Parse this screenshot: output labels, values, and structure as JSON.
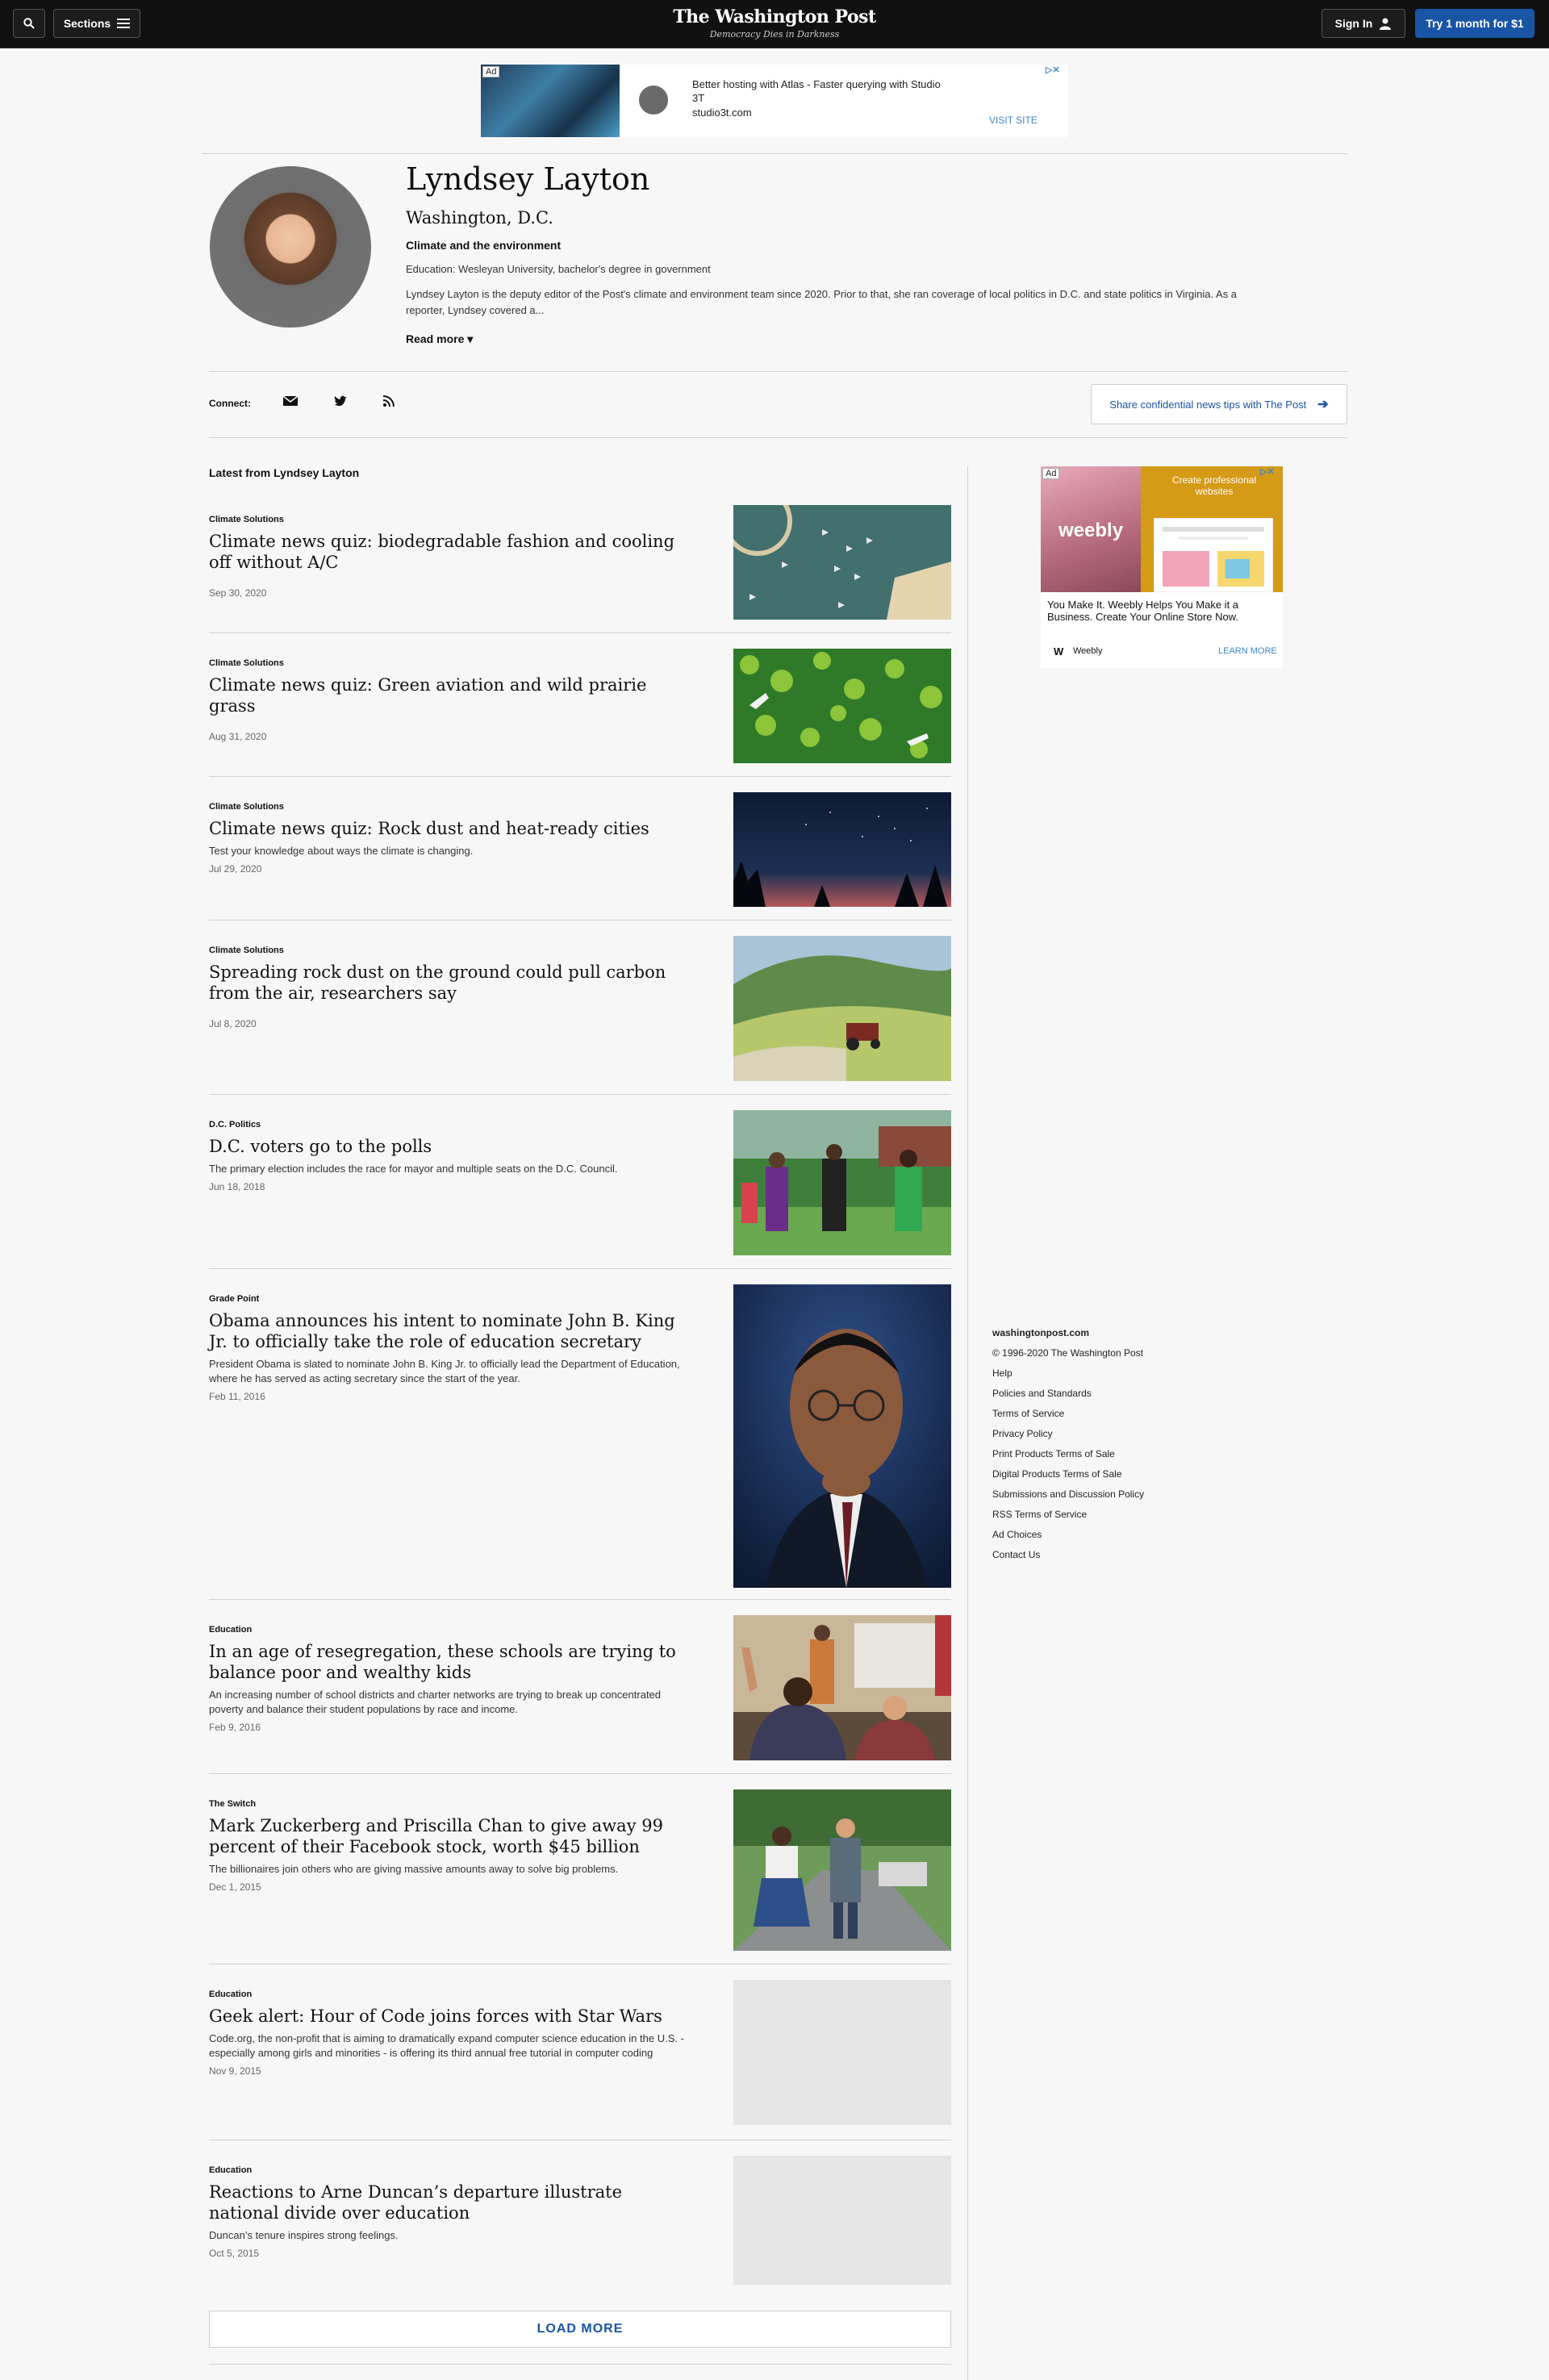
{
  "header": {
    "sections_label": "Sections",
    "logo_name": "The Washington Post",
    "logo_tagline": "Democracy Dies in Darkness",
    "signin_label": "Sign In",
    "trial_label": "Try 1 month for $1"
  },
  "top_ad": {
    "badge": "Ad",
    "title": "Better hosting with Atlas - Faster querying with Studio 3T",
    "domain": "studio3t.com",
    "cta": "VISIT SITE"
  },
  "author": {
    "name": "Lyndsey Layton",
    "location": "Washington, D.C.",
    "beat": "Climate and the environment",
    "education": "Education: Wesleyan University, bachelor's degree in government",
    "bio": "Lyndsey Layton is the deputy editor of the Post's climate and environment team since 2020. Prior to that, she ran coverage of local politics in D.C. and state politics in Virginia. As a reporter, Lyndsey covered a...",
    "read_more": "Read more"
  },
  "connect": {
    "label": "Connect:",
    "icons": [
      "email-icon",
      "twitter-icon",
      "rss-icon"
    ],
    "tips_label": "Share confidential news tips with The Post"
  },
  "latest_heading": "Latest from Lyndsey Layton",
  "articles": [
    {
      "kicker": "Climate Solutions",
      "headline": "Climate news quiz: biodegradable fashion and cooling off without A/C",
      "blurb": "",
      "date": "Sep 30, 2020"
    },
    {
      "kicker": "Climate Solutions",
      "headline": "Climate news quiz: Green aviation and wild prairie grass",
      "blurb": "",
      "date": "Aug 31, 2020"
    },
    {
      "kicker": "Climate Solutions",
      "headline": "Climate news quiz: Rock dust and heat-ready cities",
      "blurb": "Test your knowledge about ways the climate is changing.",
      "date": "Jul 29, 2020"
    },
    {
      "kicker": "Climate Solutions",
      "headline": "Spreading rock dust on the ground could pull carbon from the air, researchers say",
      "blurb": "",
      "date": "Jul 8, 2020"
    },
    {
      "kicker": "D.C. Politics",
      "headline": "D.C. voters go to the polls",
      "blurb": "The primary election includes the race for mayor and multiple seats on the D.C. Council.",
      "date": "Jun 18, 2018"
    },
    {
      "kicker": "Grade Point",
      "headline": "Obama announces his intent to nominate John B. King Jr. to officially take the role of education secretary",
      "blurb": "President Obama is slated to nominate John B. King Jr. to officially lead the Department of Education, where he has served as acting secretary since the start of the year.",
      "date": "Feb 11, 2016"
    },
    {
      "kicker": "Education",
      "headline": "In an age of resegregation, these schools are trying to balance poor and wealthy kids",
      "blurb": "An increasing number of school districts and charter networks are trying to break up concentrated poverty and balance their student populations by race and income.",
      "date": "Feb 9, 2016"
    },
    {
      "kicker": "The Switch",
      "headline": "Mark Zuckerberg and Priscilla Chan to give away 99 percent of their Facebook stock, worth $45 billion",
      "blurb": "The billionaires join others who are giving massive amounts away to solve big problems.",
      "date": "Dec 1, 2015"
    },
    {
      "kicker": "Education",
      "headline": "Geek alert: Hour of Code joins forces with Star Wars",
      "blurb": "Code.org, the non-profit that is aiming to dramatically expand computer science education in the U.S. - especially among girls and minorities - is offering its third annual free tutorial in computer coding",
      "date": "Nov 9, 2015"
    },
    {
      "kicker": "Education",
      "headline": "Reactions to Arne Duncan’s departure illustrate national divide over education",
      "blurb": "Duncan’s tenure inspires strong feelings.",
      "date": "Oct 5, 2015"
    }
  ],
  "load_more": "LOAD MORE",
  "right_ad": {
    "badge": "Ad",
    "logo": "weebly",
    "headline": "Create professional websites",
    "body": "You Make It. Weebly Helps You Make it a Business. Create Your Online Store Now.",
    "brand": "Weebly",
    "cta": "LEARN MORE"
  },
  "footer": {
    "site": "washingtonpost.com",
    "copyright": "© 1996-2020 The Washington Post",
    "links": [
      "Help",
      "Policies and Standards",
      "Terms of Service",
      "Privacy Policy",
      "Print Products Terms of Sale",
      "Digital Products Terms of Sale",
      "Submissions and Discussion Policy",
      "RSS Terms of Service",
      "Ad Choices",
      "Contact Us"
    ]
  }
}
